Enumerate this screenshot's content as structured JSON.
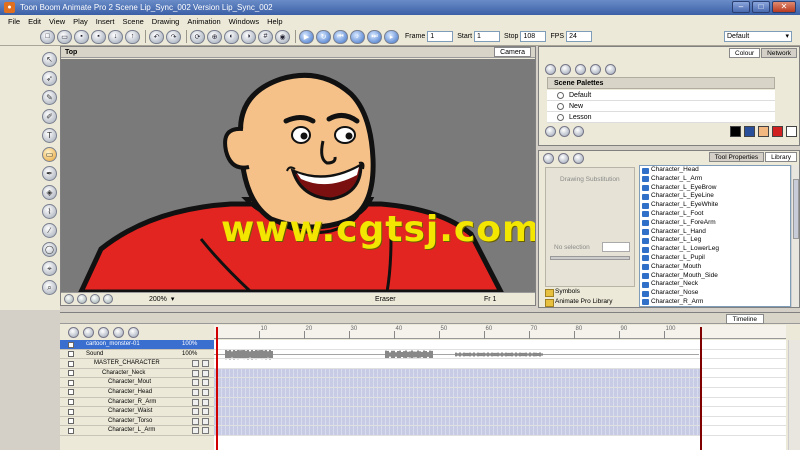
{
  "window": {
    "title": "Toon Boom Animate Pro 2 Scene Lip_Sync_002 Version Lip_Sync_002"
  },
  "menu": [
    "File",
    "Edit",
    "View",
    "Play",
    "Insert",
    "Scene",
    "Drawing",
    "Animation",
    "Windows",
    "Help"
  ],
  "toolbar": {
    "frame_label": "Frame",
    "frame_value": "1",
    "start_label": "Start",
    "start_value": "1",
    "stop_label": "Stop",
    "stop_value": "108",
    "fps_label": "FPS",
    "fps_value": "24",
    "workspace": "Default"
  },
  "camera": {
    "view_label": "Top",
    "tab": "Camera",
    "zoom": "200%",
    "tool_mode": "Eraser",
    "frame_readout": "Fr 1",
    "watermark": "www.cgtsj.com"
  },
  "colour_panel": {
    "tabs": [
      "Colour",
      "Network"
    ],
    "header": "Scene Palettes",
    "palettes": [
      "Default",
      "New",
      "Lesson"
    ],
    "swatch_colors": [
      "#000000",
      "#2a4f9a",
      "#f2b880",
      "#d02020",
      "#ffffff"
    ]
  },
  "library_panel": {
    "tabs": [
      "Tool Properties",
      "Library"
    ],
    "substitution_title": "Drawing Substitution",
    "no_selection": "No selection",
    "tree": [
      "Symbols",
      "Animate Pro Library"
    ],
    "items": [
      "Character_Head",
      "Character_L_Arm",
      "Character_L_EyeBrow",
      "Character_L_EyeLine",
      "Character_L_EyeWhite",
      "Character_L_Foot",
      "Character_L_ForeArm",
      "Character_L_Hand",
      "Character_L_Leg",
      "Character_L_LowerLeg",
      "Character_L_Pupil",
      "Character_Mouth",
      "Character_Mouth_Side",
      "Character_Neck",
      "Character_Nose",
      "Character_R_Arm"
    ]
  },
  "timeline": {
    "tab": "Timeline",
    "ruler_ticks": [
      "10",
      "20",
      "30",
      "40",
      "50",
      "60",
      "70",
      "80",
      "90",
      "100"
    ],
    "layers": [
      {
        "name": "cartoon_monster-01",
        "pct": "100%",
        "kind": "sound",
        "selected": true
      },
      {
        "name": "Sound",
        "pct": "100%",
        "kind": "sound",
        "selected": false
      },
      {
        "name": "MASTER_CHARACTER",
        "pct": "",
        "kind": "peg",
        "selected": false
      },
      {
        "name": "Character_Neck",
        "pct": "",
        "kind": "drawing",
        "selected": false
      },
      {
        "name": "Character_Mout",
        "pct": "",
        "kind": "drawing",
        "selected": false
      },
      {
        "name": "Character_Head",
        "pct": "",
        "kind": "drawing",
        "selected": false
      },
      {
        "name": "Character_R_Arm",
        "pct": "",
        "kind": "drawing",
        "selected": false
      },
      {
        "name": "Character_Waist",
        "pct": "",
        "kind": "drawing",
        "selected": false
      },
      {
        "name": "Character_Torso",
        "pct": "",
        "kind": "drawing",
        "selected": false
      },
      {
        "name": "Character_L_Arm",
        "pct": "",
        "kind": "drawing",
        "selected": false
      }
    ]
  }
}
